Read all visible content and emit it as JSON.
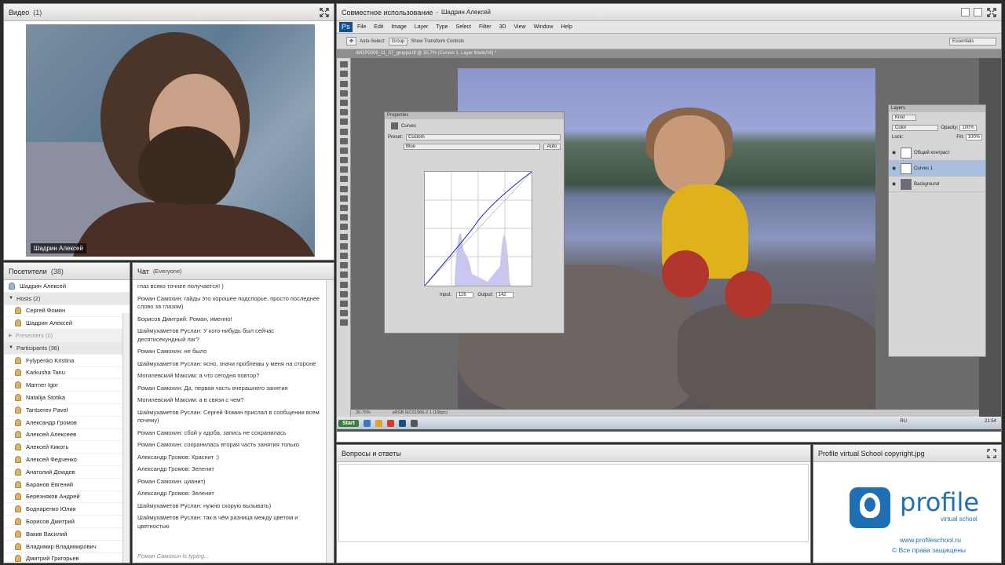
{
  "video": {
    "title": "Видео",
    "count": "(1)",
    "presenter_name": "Шадрин Алексей"
  },
  "attendees": {
    "title": "Посетители",
    "count": "(38)",
    "me": "Шадрин Алексей",
    "hosts_label": "Hosts (2)",
    "hosts": [
      "Сергей Фомин",
      "Шадрин Алексей"
    ],
    "presenters_label": "Presenters (0)",
    "participants_label": "Participants (36)",
    "participants": [
      "Fylypenko Kristina",
      "Karkusha Tanu",
      "Marmer Igor",
      "Natalija Stotika",
      "Tantserev Pavel",
      "Александр Громов",
      "Алексей Алексеев",
      "Алексей Кикоть",
      "Алексей Федченко",
      "Анатолий Доwдев",
      "Баранов Евгений",
      "Березняков Андрей",
      "Боднаренко Юлия",
      "Борисов Дмитрий",
      "Вакив Василий",
      "Владимир Владимирович",
      "Дмитрий Григорьев"
    ]
  },
  "chat": {
    "title": "Чат",
    "scope": "(Everyone)",
    "messages": [
      {
        "text": "глаз всяко точнее получается! )"
      },
      {
        "text": "Роман Самохин: гайды это хорошее подспорье, просто последнее слово за глазом)"
      },
      {
        "text": "Борисов Дмитрий: Роман, именно!"
      },
      {
        "text": "Шаймухаметов Руслан: У кого-нибудь был сейчас десятисекундный лаг?"
      },
      {
        "text": "Роман Самохин: не было"
      },
      {
        "text": "Шаймухаметов Руслан: ясно, значи проблемы у меня на стороне"
      },
      {
        "text": "Могилевский Максим: а что сегодня повтор?"
      },
      {
        "text": "Роман Самохин: Да, первая часть вчерашнего занятия"
      },
      {
        "text": "Могилевский Максим: а в связи с чем?"
      },
      {
        "text": "Шаймухаметов Руслан: Сергей Фомин прислал в сообщении всем почему)"
      },
      {
        "text": "Роман Самохин: сбой у адоба, запись не сохранилась"
      },
      {
        "text": "Роман Самохин: сохранилась вторая часть занятия только"
      },
      {
        "text": "Александр Громов: Краснит :)"
      },
      {
        "text": "Александр Громов: Зеленит"
      },
      {
        "text": "Роман Самохин: цианит)"
      },
      {
        "text": "Александр Громов: Зеленит"
      },
      {
        "text": "Шаймухаметов Руслан: нужно скорую вызывать)"
      },
      {
        "text": "Шаймухаметов Руслан: так в чём разница между цветом и цветностью"
      }
    ],
    "typing": "Роман Самохин is typing..."
  },
  "share": {
    "title": "Совместное использование",
    "separator": "-",
    "presenter": "Шадрин Алексей",
    "ps": {
      "logo": "Ps",
      "menu": [
        "File",
        "Edit",
        "Image",
        "Layer",
        "Type",
        "Select",
        "Filter",
        "3D",
        "View",
        "Window",
        "Help"
      ],
      "opts": [
        "Auto-Select:",
        "Group",
        "Show Transform Controls"
      ],
      "workspace": "Essentials",
      "doc_tab": "IMGP0006_11_07_gruppa.tif @ 30,7% (Curves 1, Layer Mask/16) *",
      "props_title": "Properties",
      "props_sub": "Curves",
      "preset_label": "Preset:",
      "preset": "Custom",
      "channel": "Blue",
      "auto": "Auto",
      "input_label": "Input:",
      "input_val": "126",
      "output_label": "Output:",
      "output_val": "142",
      "layers_title": "Layers",
      "kind": "Kind",
      "blend": "Color",
      "opacity_label": "Opacity:",
      "opacity": "100%",
      "lock_label": "Lock:",
      "fill_label": "Fill:",
      "fill": "100%",
      "layers": [
        "Общий контраст",
        "Curves 1",
        "Background"
      ],
      "status_zoom": "30.75%",
      "status_profile": "sRGB IEC61966-2.1 (16bpc)",
      "taskbar_start": "Start",
      "taskbar_lang": "RU",
      "taskbar_time": "21:54"
    }
  },
  "qa": {
    "title": "Вопросы и ответы"
  },
  "file": {
    "title": "Profile virtual School copyright.jpg",
    "logo_text": "profile",
    "logo_sub": "virtual school",
    "url": "www.profileschool.ru",
    "copyright": "© Все права защищены"
  },
  "colors": {
    "brand": "#1f6fb5",
    "selected_layer": "#a9bfe0"
  }
}
